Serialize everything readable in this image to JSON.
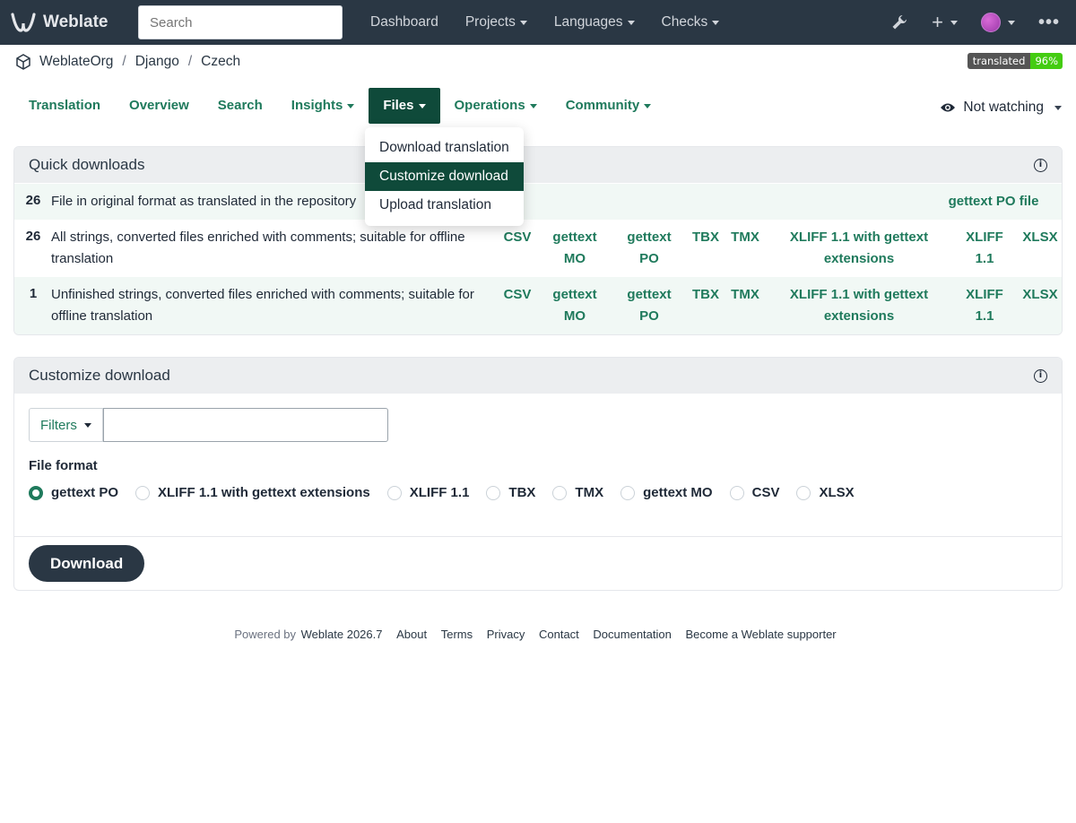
{
  "app": {
    "name": "Weblate"
  },
  "topbar": {
    "search_placeholder": "Search",
    "nav": [
      {
        "label": "Dashboard",
        "dropdown": false
      },
      {
        "label": "Projects",
        "dropdown": true
      },
      {
        "label": "Languages",
        "dropdown": true
      },
      {
        "label": "Checks",
        "dropdown": true
      }
    ],
    "icons": [
      "wrench-icon",
      "plus-icon",
      "avatar",
      "more-icon"
    ]
  },
  "breadcrumb": {
    "items": [
      "WeblateOrg",
      "Django",
      "Czech"
    ]
  },
  "badge": {
    "label": "translated",
    "value": "96%"
  },
  "tabs": {
    "items": [
      {
        "label": "Translation",
        "dropdown": false,
        "active": false
      },
      {
        "label": "Overview",
        "dropdown": false,
        "active": false
      },
      {
        "label": "Search",
        "dropdown": false,
        "active": false
      },
      {
        "label": "Insights",
        "dropdown": true,
        "active": false
      },
      {
        "label": "Files",
        "dropdown": true,
        "active": true
      },
      {
        "label": "Operations",
        "dropdown": true,
        "active": false
      },
      {
        "label": "Community",
        "dropdown": true,
        "active": false
      }
    ],
    "watch_label": "Not watching"
  },
  "files_menu": {
    "items": [
      {
        "label": "Download translation",
        "active": false
      },
      {
        "label": "Customize download",
        "active": true
      },
      {
        "label": "Upload translation",
        "active": false
      }
    ]
  },
  "quick_downloads": {
    "title": "Quick downloads",
    "rows": [
      {
        "count": "26",
        "description": "File in original format as translated in the repository",
        "formats": [
          "gettext PO file"
        ]
      },
      {
        "count": "26",
        "description": "All strings, converted files enriched with comments; suitable for offline translation",
        "formats": [
          "CSV",
          "gettext MO",
          "gettext PO",
          "TBX",
          "TMX",
          "XLIFF 1.1 with gettext extensions",
          "XLIFF 1.1",
          "XLSX"
        ]
      },
      {
        "count": "1",
        "description": "Unfinished strings, converted files enriched with comments; suitable for offline translation",
        "formats": [
          "CSV",
          "gettext MO",
          "gettext PO",
          "TBX",
          "TMX",
          "XLIFF 1.1 with gettext extensions",
          "XLIFF 1.1",
          "XLSX"
        ]
      }
    ]
  },
  "customize_download": {
    "title": "Customize download",
    "filters_label": "Filters",
    "query_value": "",
    "file_format_label": "File format",
    "formats": [
      {
        "label": "gettext PO",
        "selected": true
      },
      {
        "label": "XLIFF 1.1 with gettext extensions",
        "selected": false
      },
      {
        "label": "XLIFF 1.1",
        "selected": false
      },
      {
        "label": "TBX",
        "selected": false
      },
      {
        "label": "TMX",
        "selected": false
      },
      {
        "label": "gettext MO",
        "selected": false
      },
      {
        "label": "CSV",
        "selected": false
      },
      {
        "label": "XLSX",
        "selected": false
      }
    ],
    "download_label": "Download"
  },
  "footer": {
    "powered_by": "Powered by",
    "version_link": "Weblate 2026.7",
    "links": [
      "About",
      "Terms",
      "Privacy",
      "Contact",
      "Documentation",
      "Become a Weblate supporter"
    ]
  },
  "colors": {
    "navbar": "#2a3744",
    "accent": "#1f7a5c",
    "active_tab": "#0f4a3a",
    "badge_ok": "#44cc11"
  }
}
